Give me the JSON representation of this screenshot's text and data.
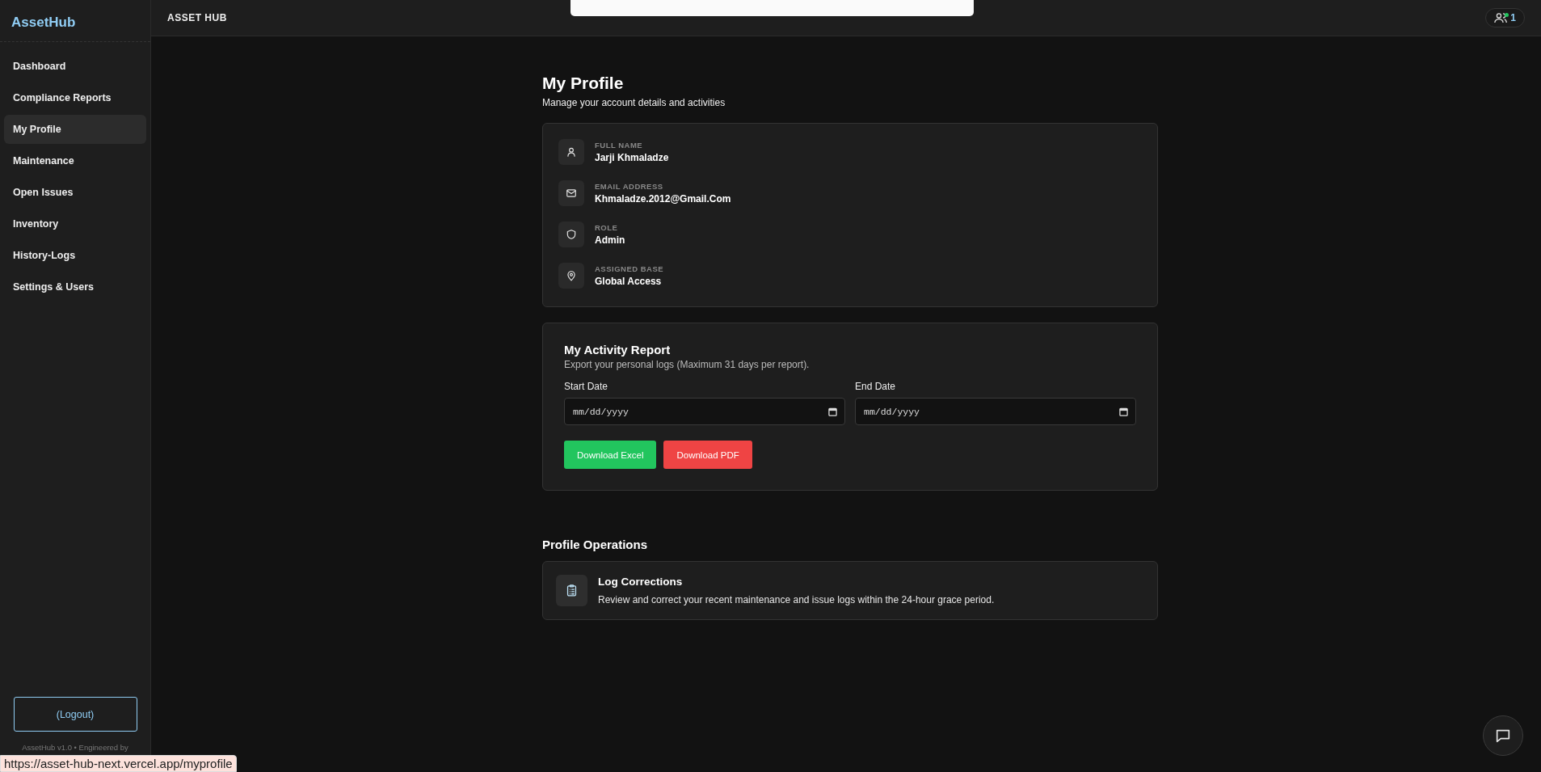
{
  "sidebar": {
    "logo": "AssetHub",
    "items": [
      {
        "label": "Dashboard",
        "selected": false
      },
      {
        "label": "Compliance Reports",
        "selected": false
      },
      {
        "label": "My Profile",
        "selected": true
      },
      {
        "label": "Maintenance",
        "selected": false
      },
      {
        "label": "Open Issues",
        "selected": false
      },
      {
        "label": "Inventory",
        "selected": false
      },
      {
        "label": "History-Logs",
        "selected": false
      },
      {
        "label": "Settings & Users",
        "selected": false
      }
    ],
    "logout": "(Logout)",
    "footer": "AssetHub v1.0 • Engineered by"
  },
  "topbar": {
    "title": "ASSET HUB",
    "users_count": "1"
  },
  "page": {
    "title": "My Profile",
    "subtitle": "Manage your account details and activities"
  },
  "profile": [
    {
      "kind": "person",
      "label": "FULL NAME",
      "value": "Jarji Khmaladze"
    },
    {
      "kind": "mail",
      "label": "EMAIL ADDRESS",
      "value": "Khmaladze.2012@Gmail.Com"
    },
    {
      "kind": "shield",
      "label": "ROLE",
      "value": "Admin"
    },
    {
      "kind": "pin",
      "label": "ASSIGNED BASE",
      "value": "Global Access"
    }
  ],
  "report": {
    "title": "My Activity Report",
    "subtitle": "Export your personal logs (Maximum 31 days per report).",
    "fields": [
      {
        "label": "Start Date",
        "placeholder": "mm/dd/yyyy"
      },
      {
        "label": "End Date",
        "placeholder": "mm/dd/yyyy"
      }
    ],
    "buttons": [
      {
        "label": "Download Excel",
        "kind": "excel"
      },
      {
        "label": "Download PDF",
        "kind": "pdf"
      }
    ]
  },
  "operations": {
    "title": "Profile Operations",
    "items": [
      {
        "title": "Log Corrections",
        "description": "Review and correct your recent maintenance and issue logs within the 24-hour grace period."
      }
    ]
  },
  "status_url": "https://asset-hub-next.vercel.app/myprofile"
}
